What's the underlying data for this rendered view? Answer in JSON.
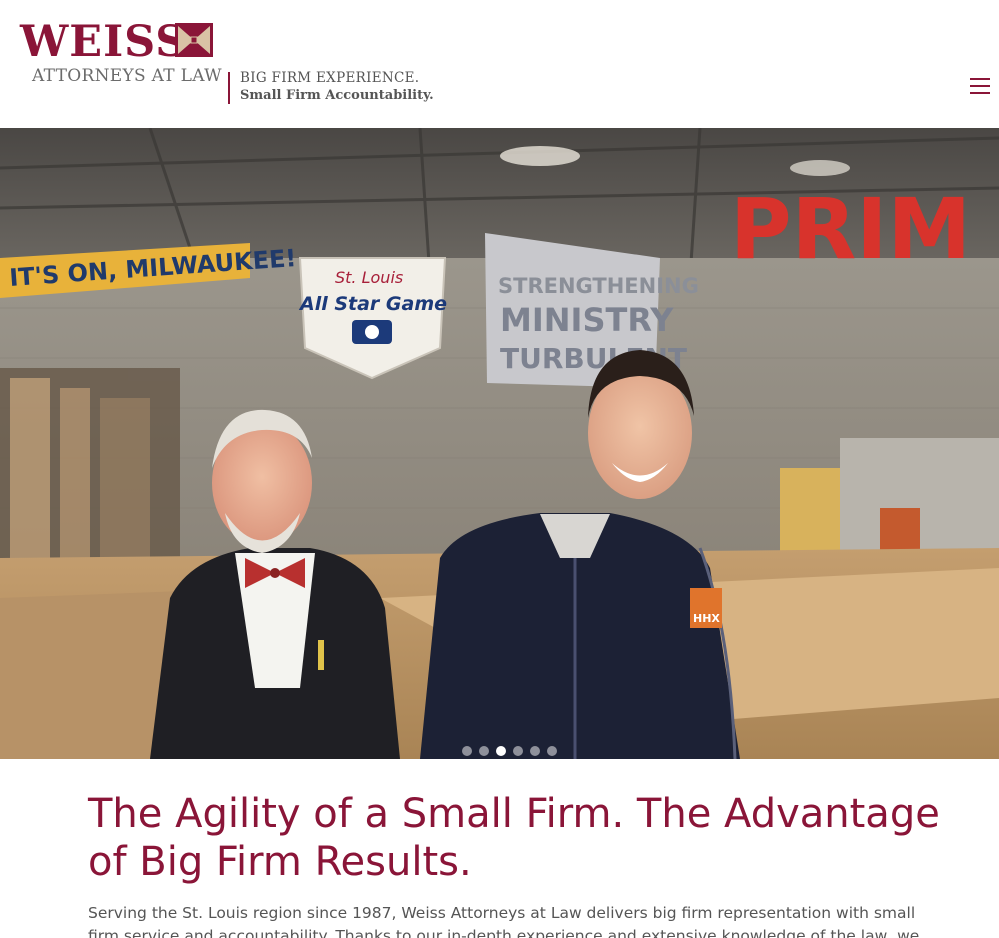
{
  "header": {
    "logo": {
      "wordmark": "WEISS",
      "subtitle": "ATTORNEYS AT LAW",
      "tagline_line1": "BIG FIRM EXPERIENCE.",
      "tagline_line2": "Small Firm Accountability."
    },
    "menu_icon": "hamburger-menu-icon"
  },
  "hero": {
    "background_signage": {
      "banner": "IT'S ON, MILWAUKEE!",
      "emblem_script": "St. Louis",
      "emblem_title": "All Star Game",
      "sign_line1": "STRENGTHENING",
      "sign_line2": "MINISTRY",
      "sign_line3": "TURBULENT",
      "wall_letters": "PRIM",
      "jacket_patch": "HHX"
    },
    "slider": {
      "slide_count": 6,
      "active_index": 2
    }
  },
  "intro": {
    "heading": "The Agility of a Small Firm. The Advantage of Big Firm Results.",
    "body": "Serving the St. Louis region since 1987, Weiss Attorneys at Law delivers big firm representation with small firm service and accountability. Thanks to our in-depth experience and extensive knowledge of the law, we know what"
  },
  "colors": {
    "brand": "#8a1538",
    "text": "#555555",
    "background": "#ffffff"
  }
}
